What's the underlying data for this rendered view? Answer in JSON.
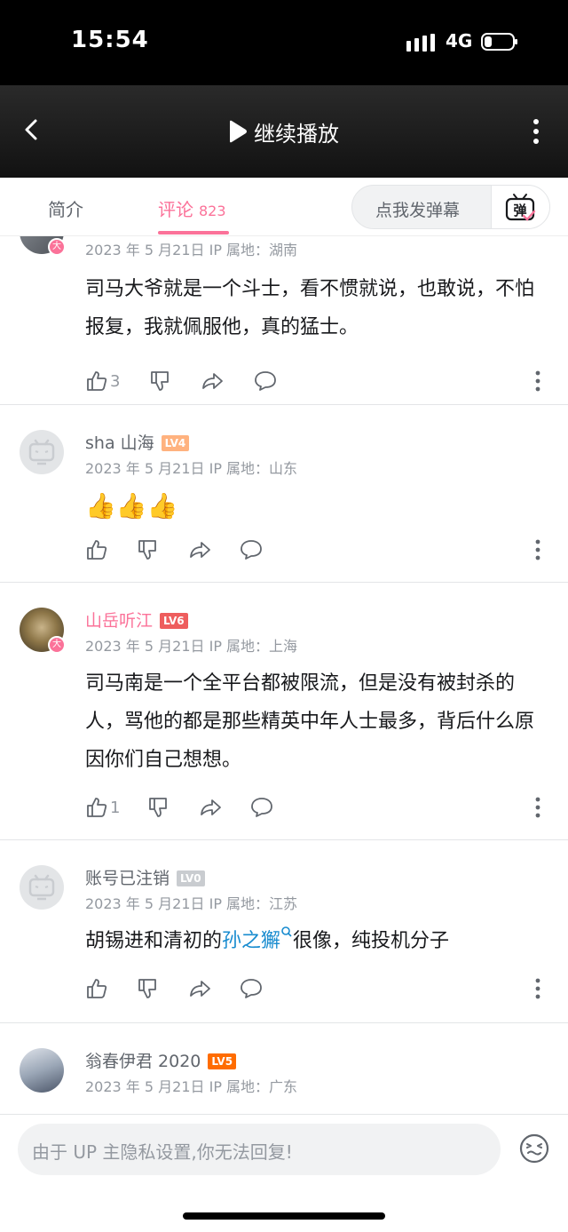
{
  "status_bar": {
    "time": "15:54",
    "network": "4G"
  },
  "nav": {
    "title": "继续播放"
  },
  "tabs": {
    "intro_label": "简介",
    "comments_label": "评论",
    "comments_count": "823",
    "danmaku_placeholder": "点我发弹幕",
    "danmaku_button_label": "弹"
  },
  "comments": [
    {
      "username": "",
      "meta": "2023 年 5 月21日  IP 属地：湖南",
      "content": "司马大爷就是一个斗士，看不惯就说，也敢说，不怕报复，我就佩服他，真的猛士。",
      "likes": "3",
      "avatar_badge": "大"
    },
    {
      "username": "sha 山海",
      "level": "LV4",
      "level_color": "#ffb27f",
      "meta": "2023 年 5 月21日  IP 属地：山东",
      "content": "👍👍👍",
      "likes": ""
    },
    {
      "username": "山岳听江",
      "level": "LV6",
      "level_color": "#ee5d5d",
      "meta": "2023 年 5 月21日  IP 属地：上海",
      "content": "司马南是一个全平台都被限流，但是没有被封杀的人，骂他的都是那些精英中年人士最多，背后什么原因你们自己想想。",
      "likes": "1",
      "avatar_badge": "大"
    },
    {
      "username": "账号已注销",
      "level": "LV0",
      "level_color": "#c9ccd0",
      "meta": "2023 年 5 月21日  IP 属地：江苏",
      "content_before": "胡锡进和清初的",
      "content_link": "孙之獬",
      "content_after": "很像，纯投机分子",
      "likes": ""
    },
    {
      "username": "翁春伊君 2020",
      "level": "LV5",
      "level_color": "#ff6c00",
      "meta": "2023 年 5 月21日  IP 属地：广东"
    }
  ],
  "reply": {
    "placeholder": "由于 UP 主隐私设置,你无法回复!"
  },
  "colors": {
    "accent": "#fb7299",
    "link": "#178bcf",
    "muted": "#9499a0"
  }
}
